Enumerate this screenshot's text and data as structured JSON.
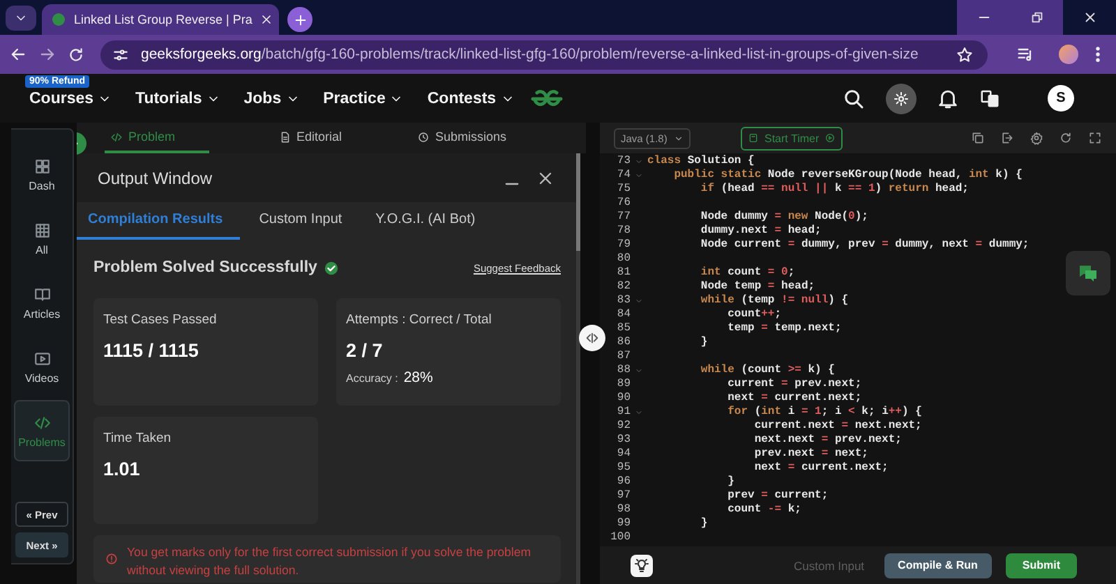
{
  "browser": {
    "tab_title": "Linked List Group Reverse | Pra",
    "url_host": "geeksforgeeks.org",
    "url_path": "/batch/gfg-160-problems/track/linked-list-gfg-160/problem/reverse-a-linked-list-in-groups-of-given-size"
  },
  "nav": {
    "badge": "90% Refund",
    "menu": [
      "Courses",
      "Tutorials",
      "Jobs",
      "Practice",
      "Contests"
    ],
    "avatar": "S"
  },
  "sidebar": {
    "items": [
      {
        "label": "Dash",
        "selected": false
      },
      {
        "label": "All",
        "selected": false
      },
      {
        "label": "Articles",
        "selected": false
      },
      {
        "label": "Videos",
        "selected": false
      },
      {
        "label": "Problems",
        "selected": true
      }
    ],
    "prev": "« Prev",
    "next": "Next »"
  },
  "problem_tabs": [
    {
      "label": "Problem",
      "selected": true
    },
    {
      "label": "Editorial",
      "selected": false
    },
    {
      "label": "Submissions",
      "selected": false
    }
  ],
  "output_window": {
    "title": "Output Window",
    "tabs": [
      {
        "label": "Compilation Results",
        "selected": true
      },
      {
        "label": "Custom Input",
        "selected": false
      },
      {
        "label": "Y.O.G.I. (AI Bot)",
        "selected": false
      }
    ],
    "status": "Problem Solved Successfully",
    "feedback": "Suggest Feedback",
    "test_cases": {
      "label": "Test Cases Passed",
      "value": "1115 / 1115"
    },
    "attempts": {
      "label": "Attempts : Correct / Total",
      "value": "2 / 7",
      "accuracy_label": "Accuracy :",
      "accuracy": "28%"
    },
    "time": {
      "label": "Time Taken",
      "value": "1.01"
    },
    "notice": "You get marks only for the first correct submission if you solve the problem without viewing the full solution."
  },
  "editor": {
    "language": "Java (1.8)",
    "timer": "Start Timer",
    "lines": [
      {
        "number": "73",
        "fold": true,
        "segments": [
          {
            "kind": "kw",
            "text": "class"
          },
          {
            "kind": "pl",
            "text": " Solution {"
          }
        ]
      },
      {
        "number": "74",
        "fold": true,
        "segments": [
          {
            "kind": "kw",
            "text": "    public static"
          },
          {
            "kind": "pl",
            "text": " Node reverseKGroup(Node head, "
          },
          {
            "kind": "kw",
            "text": "int"
          },
          {
            "kind": "pl",
            "text": " k) {"
          }
        ]
      },
      {
        "number": "75",
        "fold": false,
        "segments": [
          {
            "kind": "kw",
            "text": "        if"
          },
          {
            "kind": "pl",
            "text": " (head "
          },
          {
            "kind": "lit",
            "text": "== null ||"
          },
          {
            "kind": "pl",
            "text": " k "
          },
          {
            "kind": "lit",
            "text": "== 1"
          },
          {
            "kind": "pl",
            "text": ") "
          },
          {
            "kind": "kw",
            "text": "return"
          },
          {
            "kind": "pl",
            "text": " head;"
          }
        ]
      },
      {
        "number": "76",
        "fold": false
      },
      {
        "number": "77",
        "fold": false,
        "segments": [
          {
            "kind": "pl",
            "text": "        Node dummy "
          },
          {
            "kind": "lit",
            "text": "= "
          },
          {
            "kind": "kw",
            "text": "new"
          },
          {
            "kind": "pl",
            "text": " Node("
          },
          {
            "kind": "lit",
            "text": "0"
          },
          {
            "kind": "pl",
            "text": ");"
          }
        ]
      },
      {
        "number": "78",
        "fold": false,
        "segments": [
          {
            "kind": "pl",
            "text": "        dummy.next "
          },
          {
            "kind": "lit",
            "text": "="
          },
          {
            "kind": "pl",
            "text": " head;"
          }
        ]
      },
      {
        "number": "79",
        "fold": false,
        "segments": [
          {
            "kind": "pl",
            "text": "        Node current "
          },
          {
            "kind": "lit",
            "text": "="
          },
          {
            "kind": "pl",
            "text": " dummy, prev "
          },
          {
            "kind": "lit",
            "text": "="
          },
          {
            "kind": "pl",
            "text": " dummy, next "
          },
          {
            "kind": "lit",
            "text": "="
          },
          {
            "kind": "pl",
            "text": " dummy;"
          }
        ]
      },
      {
        "number": "80",
        "fold": false
      },
      {
        "number": "81",
        "fold": false,
        "segments": [
          {
            "kind": "kw",
            "text": "        int"
          },
          {
            "kind": "pl",
            "text": " count "
          },
          {
            "kind": "lit",
            "text": "= 0"
          },
          {
            "kind": "pl",
            "text": ";"
          }
        ]
      },
      {
        "number": "82",
        "fold": false,
        "segments": [
          {
            "kind": "pl",
            "text": "        Node temp "
          },
          {
            "kind": "lit",
            "text": "="
          },
          {
            "kind": "pl",
            "text": " head;"
          }
        ]
      },
      {
        "number": "83",
        "fold": true,
        "segments": [
          {
            "kind": "kw",
            "text": "        while"
          },
          {
            "kind": "pl",
            "text": " (temp "
          },
          {
            "kind": "lit",
            "text": "!= null"
          },
          {
            "kind": "pl",
            "text": ") {"
          }
        ]
      },
      {
        "number": "84",
        "fold": false,
        "segments": [
          {
            "kind": "pl",
            "text": "            count"
          },
          {
            "kind": "lit",
            "text": "++"
          },
          {
            "kind": "pl",
            "text": ";"
          }
        ]
      },
      {
        "number": "85",
        "fold": false,
        "segments": [
          {
            "kind": "pl",
            "text": "            temp "
          },
          {
            "kind": "lit",
            "text": "="
          },
          {
            "kind": "pl",
            "text": " temp.next;"
          }
        ]
      },
      {
        "number": "86",
        "fold": false,
        "segments": [
          {
            "kind": "pl",
            "text": "        }"
          }
        ]
      },
      {
        "number": "87",
        "fold": false
      },
      {
        "number": "88",
        "fold": true,
        "segments": [
          {
            "kind": "kw",
            "text": "        while"
          },
          {
            "kind": "pl",
            "text": " (count "
          },
          {
            "kind": "lit",
            "text": ">="
          },
          {
            "kind": "pl",
            "text": " k) {"
          }
        ]
      },
      {
        "number": "89",
        "fold": false,
        "segments": [
          {
            "kind": "pl",
            "text": "            current "
          },
          {
            "kind": "lit",
            "text": "="
          },
          {
            "kind": "pl",
            "text": " prev.next;"
          }
        ]
      },
      {
        "number": "90",
        "fold": false,
        "segments": [
          {
            "kind": "pl",
            "text": "            next "
          },
          {
            "kind": "lit",
            "text": "="
          },
          {
            "kind": "pl",
            "text": " current.next;"
          }
        ]
      },
      {
        "number": "91",
        "fold": true,
        "segments": [
          {
            "kind": "kw",
            "text": "            for"
          },
          {
            "kind": "pl",
            "text": " ("
          },
          {
            "kind": "kw",
            "text": "int"
          },
          {
            "kind": "pl",
            "text": " i "
          },
          {
            "kind": "lit",
            "text": "= 1"
          },
          {
            "kind": "pl",
            "text": "; i "
          },
          {
            "kind": "lit",
            "text": "<"
          },
          {
            "kind": "pl",
            "text": " k; i"
          },
          {
            "kind": "lit",
            "text": "++"
          },
          {
            "kind": "pl",
            "text": ") {"
          }
        ]
      },
      {
        "number": "92",
        "fold": false,
        "segments": [
          {
            "kind": "pl",
            "text": "                current.next "
          },
          {
            "kind": "lit",
            "text": "="
          },
          {
            "kind": "pl",
            "text": " next.next;"
          }
        ]
      },
      {
        "number": "93",
        "fold": false,
        "segments": [
          {
            "kind": "pl",
            "text": "                next.next "
          },
          {
            "kind": "lit",
            "text": "="
          },
          {
            "kind": "pl",
            "text": " prev.next;"
          }
        ]
      },
      {
        "number": "94",
        "fold": false,
        "segments": [
          {
            "kind": "pl",
            "text": "                prev.next "
          },
          {
            "kind": "lit",
            "text": "="
          },
          {
            "kind": "pl",
            "text": " next;"
          }
        ]
      },
      {
        "number": "95",
        "fold": false,
        "segments": [
          {
            "kind": "pl",
            "text": "                next "
          },
          {
            "kind": "lit",
            "text": "="
          },
          {
            "kind": "pl",
            "text": " current.next;"
          }
        ]
      },
      {
        "number": "96",
        "fold": false,
        "segments": [
          {
            "kind": "pl",
            "text": "            }"
          }
        ]
      },
      {
        "number": "97",
        "fold": false,
        "segments": [
          {
            "kind": "pl",
            "text": "            prev "
          },
          {
            "kind": "lit",
            "text": "="
          },
          {
            "kind": "pl",
            "text": " current;"
          }
        ]
      },
      {
        "number": "98",
        "fold": false,
        "segments": [
          {
            "kind": "pl",
            "text": "            count "
          },
          {
            "kind": "lit",
            "text": "-="
          },
          {
            "kind": "pl",
            "text": " k;"
          }
        ]
      },
      {
        "number": "99",
        "fold": false,
        "segments": [
          {
            "kind": "pl",
            "text": "        }"
          }
        ]
      },
      {
        "number": "100",
        "fold": false
      }
    ],
    "custom_input": {
      "label": "Custom Input",
      "disabled": true
    },
    "compile": "Compile & Run",
    "submit": "Submit"
  }
}
